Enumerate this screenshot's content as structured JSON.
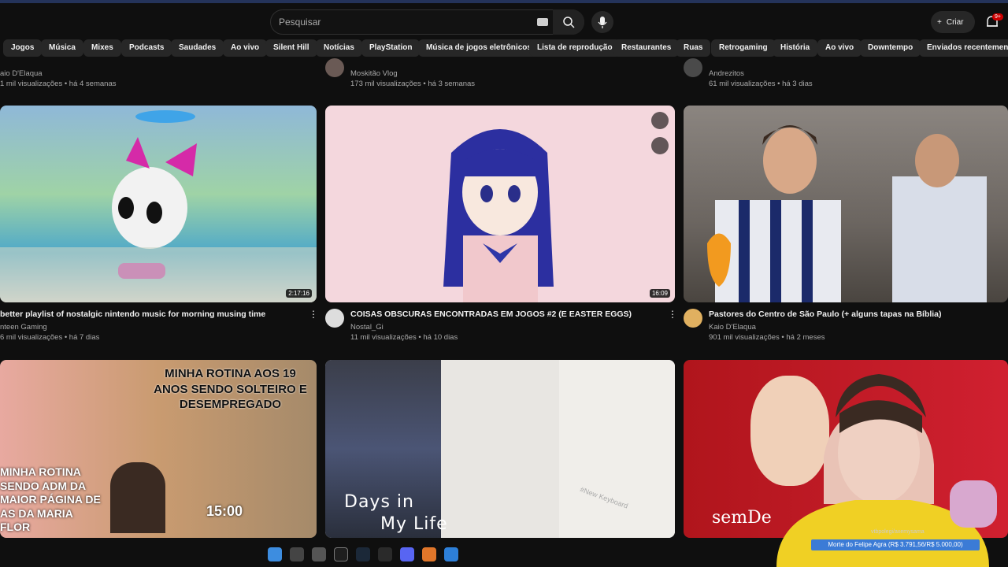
{
  "header": {
    "search_placeholder": "Pesquisar",
    "create_label": "Criar",
    "notification_badge": "9+"
  },
  "chips": [
    "Jogos",
    "Música",
    "Mixes",
    "Podcasts",
    "Saudades",
    "Ao vivo",
    "Silent Hill",
    "Notícias",
    "PlayStation",
    "Música de jogos eletrônicos",
    "Lista de reprodução",
    "Restaurantes",
    "Ruas",
    "Retrogaming",
    "História",
    "Ao vivo",
    "Downtempo",
    "Enviados recentemente"
  ],
  "top_partial": [
    {
      "channel": "aio D'Elaqua",
      "meta": "1 mil visualizações • há 4 semanas"
    },
    {
      "channel": "Moskitão Vlog",
      "meta": "173 mil visualizações • há 3 semanas"
    },
    {
      "channel": "Andrezitos",
      "meta": "61 mil visualizações • há 3 dias"
    }
  ],
  "videos": [
    {
      "title": "better playlist of nostalgic nintendo music for morning musing time",
      "channel": "nteen Gaming",
      "meta": "6 mil visualizações • há 7 dias",
      "duration": "2:17:16"
    },
    {
      "title": "COISAS OBSCURAS ENCONTRADAS EM JOGOS #2 (E EASTER EGGS)",
      "channel": "Nostal_Gi",
      "meta": "11 mil visualizações • há 10 dias",
      "duration": "16:09"
    },
    {
      "title": "Pastores do Centro de São Paulo (+ alguns tapas na Bíblia)",
      "channel": "Kaio D'Elaqua",
      "meta": "901 mil visualizações • há 2 meses",
      "duration": ""
    }
  ],
  "row3_text": {
    "rotina_a": "MINHA ROTINA AOS 19 ANOS SENDO SOLTEIRO E DESEMPREGADO",
    "rotina_b": "MINHA ROTINA SENDO ADM DA MAIOR PÁGINA DE AS DA MARIA FLOR",
    "rotina_time": "15:00",
    "days_in": "Days in",
    "my_life": "My Life",
    "new_keyboard": "#New Keyboard",
    "semdet": "semDe"
  },
  "overlay": {
    "donation_text": "Morte do Felipe Agra (R$ 3.791,56/R$ 5.000,00)",
    "watermark": "vtbpolegi/axemysama"
  },
  "colors": {
    "accent_red": "#cc0000",
    "bg": "#0f0f0f",
    "chip_bg": "#272727",
    "donation_blue": "#3b7bd6"
  }
}
